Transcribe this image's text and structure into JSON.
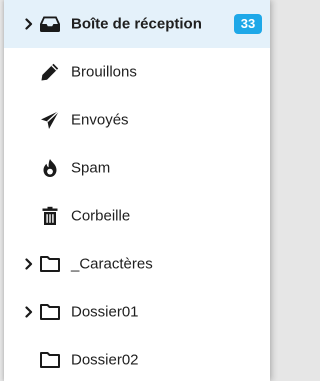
{
  "colors": {
    "active_background": "#e4f1fa",
    "badge_background": "#1ea8e8",
    "badge_text": "#ffffff",
    "text": "#1f1f1f"
  },
  "folders": [
    {
      "label": "Boîte de réception",
      "icon": "inbox-tray-icon",
      "has_chevron": true,
      "active": true,
      "badge": "33"
    },
    {
      "label": "Brouillons",
      "icon": "pencil-icon",
      "has_chevron": false,
      "active": false
    },
    {
      "label": "Envoyés",
      "icon": "paper-plane-icon",
      "has_chevron": false,
      "active": false
    },
    {
      "label": "Spam",
      "icon": "fire-icon",
      "has_chevron": false,
      "active": false
    },
    {
      "label": "Corbeille",
      "icon": "trash-icon",
      "has_chevron": false,
      "active": false
    },
    {
      "label": "_Caractères",
      "icon": "folder-outline-icon",
      "has_chevron": true,
      "active": false
    },
    {
      "label": "Dossier01",
      "icon": "folder-outline-icon",
      "has_chevron": true,
      "active": false
    },
    {
      "label": "Dossier02",
      "icon": "folder-outline-icon",
      "has_chevron": false,
      "active": false
    }
  ]
}
